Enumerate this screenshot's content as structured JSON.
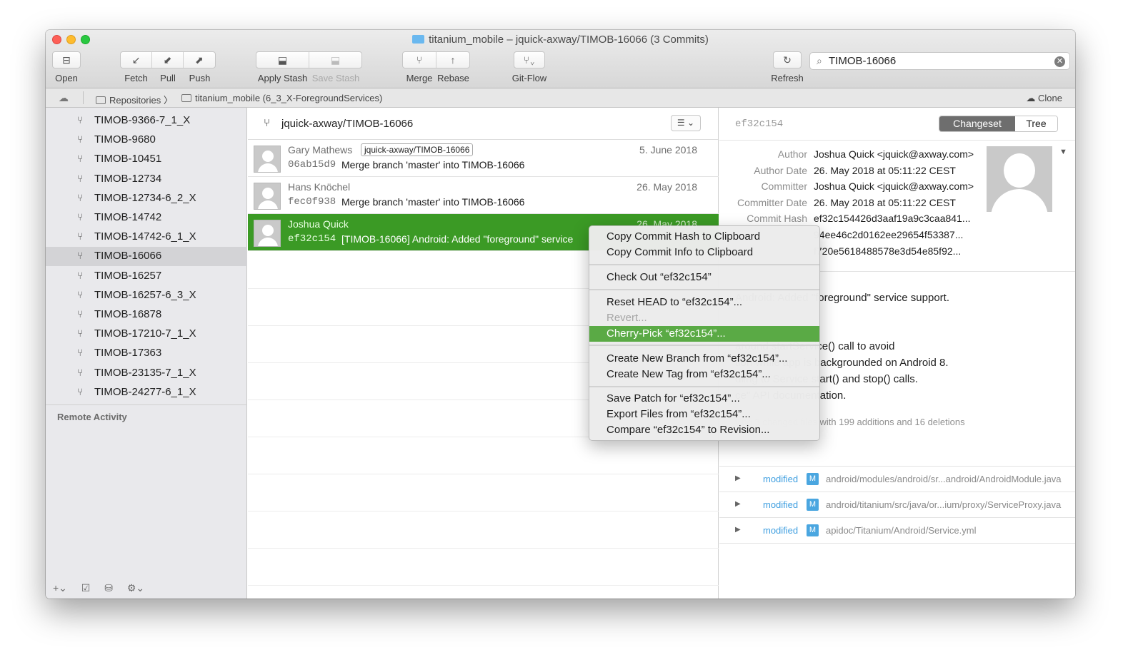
{
  "window": {
    "title": "titanium_mobile – jquick-axway/TIMOB-16066 (3 Commits)"
  },
  "toolbar": {
    "open": "Open",
    "fetch": "Fetch",
    "pull": "Pull",
    "push": "Push",
    "apply_stash": "Apply Stash",
    "save_stash": "Save Stash",
    "merge": "Merge",
    "rebase": "Rebase",
    "gitflow": "Git-Flow",
    "refresh": "Refresh",
    "search_value": "TIMOB-16066"
  },
  "pathbar": {
    "repositories": "Repositories",
    "repo": "titanium_mobile (6_3_X-ForegroundServices)",
    "clone": "Clone"
  },
  "sidebar": {
    "branches": [
      "TIMOB-9366-7_1_X",
      "TIMOB-9680",
      "TIMOB-10451",
      "TIMOB-12734",
      "TIMOB-12734-6_2_X",
      "TIMOB-14742",
      "TIMOB-14742-6_1_X",
      "TIMOB-16066",
      "TIMOB-16257",
      "TIMOB-16257-6_3_X",
      "TIMOB-16878",
      "TIMOB-17210-7_1_X",
      "TIMOB-17363",
      "TIMOB-23135-7_1_X",
      "TIMOB-24277-6_1_X"
    ],
    "selected_index": 7,
    "remote_activity": "Remote Activity"
  },
  "commits": {
    "branch": "jquick-axway/TIMOB-16066",
    "rows": [
      {
        "author": "Gary Mathews",
        "tag": "jquick-axway/TIMOB-16066",
        "date": "5. June 2018",
        "hash": "06ab15d9",
        "message": "Merge branch 'master' into TIMOB-16066"
      },
      {
        "author": "Hans Knöchel",
        "tag": "",
        "date": "26. May 2018",
        "hash": "fec0f938",
        "message": "Merge branch 'master' into TIMOB-16066"
      },
      {
        "author": "Joshua Quick",
        "tag": "",
        "date": "26. May 2018",
        "hash": "ef32c154",
        "message": "[TIMOB-16066] Android: Added \"foreground\" service"
      }
    ]
  },
  "detail": {
    "hash": "ef32c154",
    "tab_changeset": "Changeset",
    "tab_tree": "Tree",
    "meta": [
      {
        "k": "Author",
        "v": "Joshua Quick <jquick@axway.com>"
      },
      {
        "k": "Author Date",
        "v": "26. May 2018 at 05:11:22 CEST"
      },
      {
        "k": "Committer",
        "v": "Joshua Quick <jquick@axway.com>"
      },
      {
        "k": "Committer Date",
        "v": "26. May 2018 at 05:11:22 CEST"
      },
      {
        "k": "Commit Hash",
        "v": "ef32c154426d3aaf19a9c3caa841..."
      },
      {
        "k": "",
        "v": "94ee46c2d0162ee29654f53387..."
      },
      {
        "k": "",
        "v": "f720e5618488578e3d54e85f92..."
      }
    ],
    "description": [
      "Android: Added \"foreground\" service support.",
      "around startService() call to avoid",
      "tion while app is backgrounded on Android 8.",
      "dling to Service start() and stop() calls.",
      "ce\" API documentation."
    ],
    "summary": "ving 3 changed files with 199 additions and 16 deletions",
    "files": [
      {
        "status": "modified",
        "badge": "M",
        "path": "android/modules/android/sr...android/AndroidModule.java"
      },
      {
        "status": "modified",
        "badge": "M",
        "path": "android/titanium/src/java/or...ium/proxy/ServiceProxy.java"
      },
      {
        "status": "modified",
        "badge": "M",
        "path": "apidoc/Titanium/Android/Service.yml"
      }
    ]
  },
  "context_menu": {
    "copy_hash": "Copy Commit Hash to Clipboard",
    "copy_info": "Copy Commit Info to Clipboard",
    "checkout": "Check Out “ef32c154”",
    "reset": "Reset HEAD to “ef32c154”...",
    "revert": "Revert...",
    "cherry_pick": "Cherry-Pick “ef32c154”...",
    "new_branch": "Create New Branch from “ef32c154”...",
    "new_tag": "Create New Tag from “ef32c154”...",
    "save_patch": "Save Patch for “ef32c154”...",
    "export": "Export Files from “ef32c154”...",
    "compare": "Compare “ef32c154” to Revision..."
  },
  "colors": {
    "selection_green": "#3b9a25",
    "menu_highlight": "#5aaa45",
    "modified_blue": "#3f9fe0"
  }
}
